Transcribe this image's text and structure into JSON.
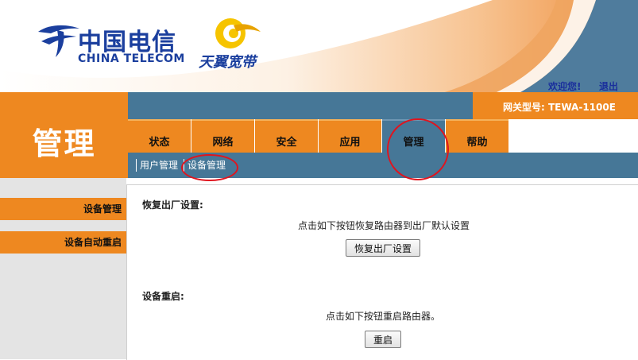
{
  "header": {
    "brand_name_cn": "中国电信",
    "brand_name_en": "CHINA TELECOM",
    "product_name": "天翼宽带",
    "welcome_link": "欢迎您!",
    "logout_link": "退出"
  },
  "page_title": "管理",
  "gateway_model": "网关型号: TEWA-1100E",
  "tabs": [
    {
      "label": "状态"
    },
    {
      "label": "网络"
    },
    {
      "label": "安全"
    },
    {
      "label": "应用"
    },
    {
      "label": "管理",
      "active": true
    },
    {
      "label": "帮助"
    }
  ],
  "subnav": [
    {
      "label": "用户管理"
    },
    {
      "label": "设备管理",
      "active": true
    }
  ],
  "sidebar": [
    {
      "label": "设备管理"
    },
    {
      "label": "设备自动重启"
    }
  ],
  "factory_reset": {
    "title": "恢复出厂设置:",
    "description": "点击如下按钮恢复路由器到出厂默认设置",
    "button": "恢复出厂设置"
  },
  "reboot": {
    "title": "设备重启:",
    "description": "点击如下按钮重启路由器。",
    "button": "重启"
  },
  "colors": {
    "orange": "#ee8820",
    "blue": "#467797",
    "link_blue": "#1a2f9c",
    "annotation_red": "#e0141e"
  }
}
